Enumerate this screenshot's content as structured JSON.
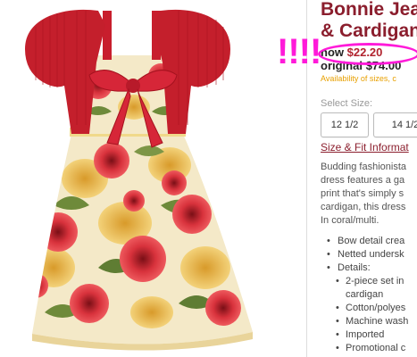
{
  "product": {
    "title_line1": "Bonnie Jea",
    "title_line2": "& Cardigan",
    "now_label": "now",
    "now_price": "$22.20",
    "original_label": "original",
    "original_price": "$74.00",
    "availability": "Availability of sizes, c"
  },
  "size_selector": {
    "label": "Select Size:",
    "options": [
      "12 1/2",
      "14 1/2"
    ]
  },
  "size_fit_link": "Size & Fit Informat",
  "description": [
    "Budding fashionista",
    "dress features a ga",
    "print that's simply s",
    "cardigan, this dress",
    "In coral/multi."
  ],
  "features": {
    "items": [
      "Bow detail crea",
      "Netted undersk",
      "Details:"
    ],
    "details": [
      "2-piece set in",
      "cardigan",
      "Cotton/polyes",
      "Machine wash",
      "Imported",
      "Promotional c"
    ]
  },
  "annotation": {
    "exclamation": "!!!!",
    "highlight_color": "#ff1ad9"
  },
  "colors": {
    "title": "#8b1e2d",
    "price": "#b1242f",
    "availability": "#e8a000"
  }
}
